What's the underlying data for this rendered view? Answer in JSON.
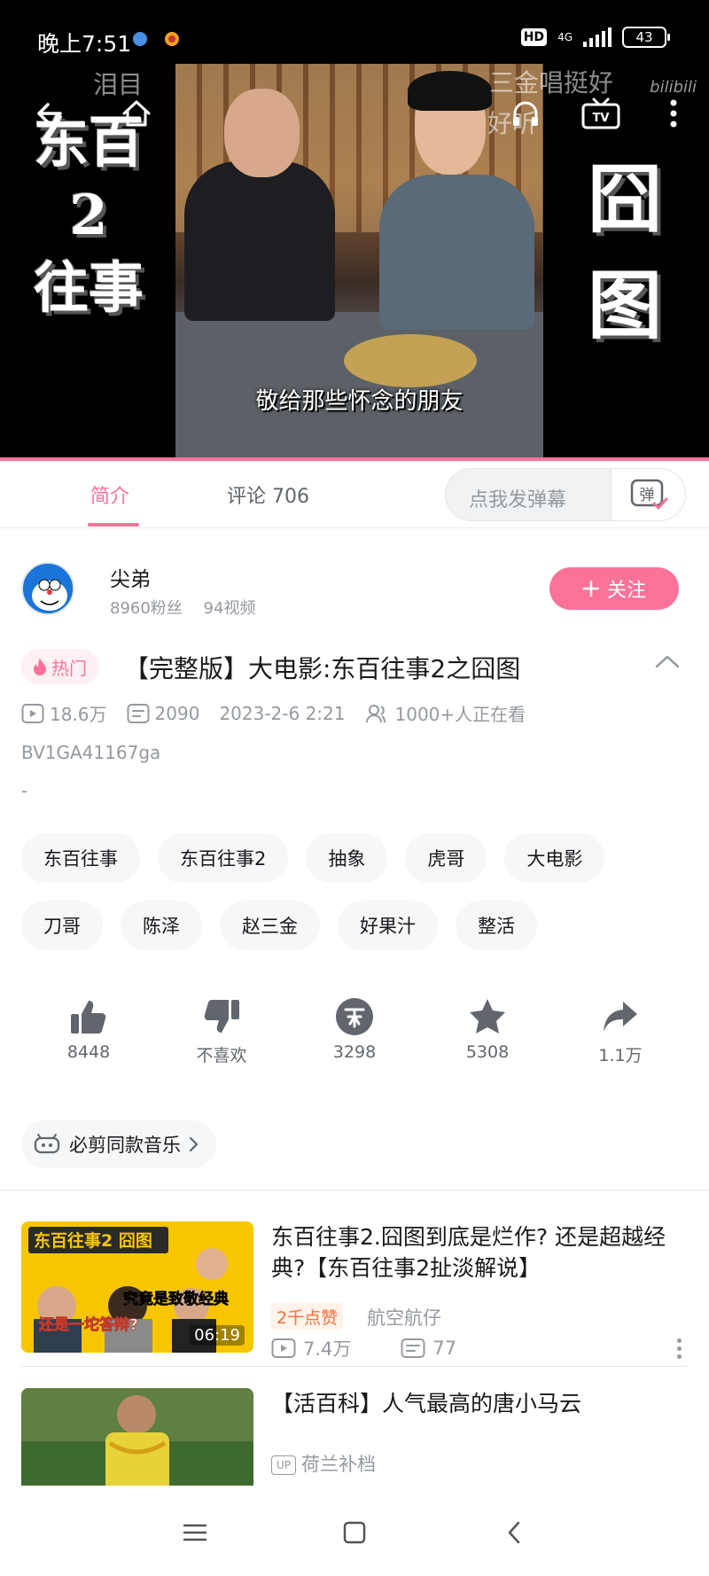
{
  "status_bar": {
    "time": "晚上7:51",
    "hd": "HD",
    "network": "4G",
    "battery": "43"
  },
  "player": {
    "side_left_lines": [
      "东百",
      "2",
      "往事"
    ],
    "side_right_lines": [
      "囧",
      "图"
    ],
    "danmaku_1": "泪目",
    "danmaku_2": "三金唱挺好",
    "danmaku_3": "好听",
    "caption": "敬给那些怀念的朋友",
    "watermark": "bilibili",
    "accent_color": "#fb7299"
  },
  "tabs": {
    "intro": "简介",
    "comments": "评论 706"
  },
  "danmaku_input": {
    "placeholder": "点我发弹幕",
    "button_glyph": "弹"
  },
  "uploader": {
    "name": "尖弟",
    "fans": "8960粉丝",
    "videos": "94视频",
    "follow_label": "关注"
  },
  "video": {
    "hot_label": "热门",
    "title": "【完整版】大电影:东百往事2之囧图",
    "views": "18.6万",
    "danmaku_count": "2090",
    "date": "2023-2-6 2:21",
    "watching": "1000+人正在看",
    "bvid": "BV1GA41167ga",
    "description": "-"
  },
  "tags": [
    "东百往事",
    "东百往事2",
    "抽象",
    "虎哥",
    "大电影",
    "刀哥",
    "陈泽",
    "赵三金",
    "好果汁",
    "整活"
  ],
  "actions": {
    "like": "8448",
    "dislike": "不喜欢",
    "coin": "3298",
    "favorite": "5308",
    "share": "1.1万"
  },
  "music": {
    "label": "必剪同款音乐"
  },
  "related": [
    {
      "title": "东百往事2.囧图到底是烂作? 还是超越经典?【东百往事2扯淡解说】",
      "badge": "2千点赞",
      "author": "航空航仔",
      "views": "7.4万",
      "danmaku": "77",
      "duration": "06:19",
      "thumb_text_top": "东百往事2 囧图",
      "thumb_text_mid": "究竟是致敬经典",
      "thumb_text_bottom": "还是一坨答辩?"
    },
    {
      "title": "【活百科】人气最高的唐小马云",
      "author": "荷兰补档",
      "up_label": "UP"
    }
  ]
}
